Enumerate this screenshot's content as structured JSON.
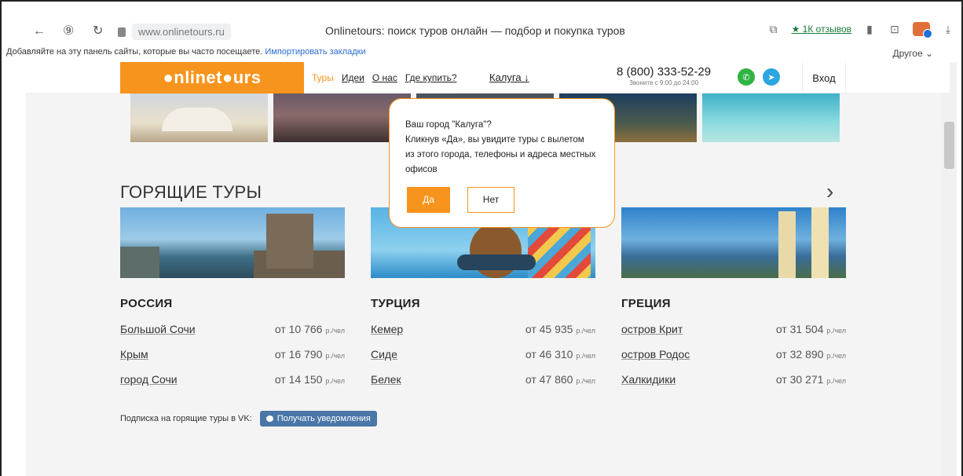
{
  "browser": {
    "url": "www.onlinetours.ru",
    "title": "Onlinetours: поиск туров онлайн — подбор и покупка туров",
    "reviews_link": "★ 1К отзывов",
    "bookmarks_prompt": "Добавляйте на эту панель сайты, которые вы часто посещаете.",
    "import_bookmarks": "Импортировать закладки",
    "other": "Другое ⌄"
  },
  "header": {
    "logo": "●nlinet●urs",
    "nav": [
      "Туры",
      "Идеи",
      "О нас",
      "Где купить?"
    ],
    "city": "Калуга ↓",
    "phone": "8 (800) 333-52-29",
    "phone_note": "Звоните с 9:00 до 24:00",
    "login": "Вход",
    "colors": {
      "brand": "#f7941d",
      "whatsapp": "#2fb343",
      "telegram": "#2ca5e0"
    }
  },
  "popup": {
    "question": "Ваш город \"Калуга\"?",
    "text_line1": "Кликнув «Да», вы увидите туры с вылетом",
    "text_line2": "из этого города, телефоны и адреса местных",
    "text_line3": "офисов",
    "yes": "Да",
    "no": "Нет"
  },
  "hot_tours": {
    "title": "ГОРЯЩИЕ ТУРЫ",
    "next": "›",
    "columns": [
      {
        "region": "РОССИЯ",
        "tours": [
          {
            "name": "Большой Сочи",
            "price": "от 10 766",
            "unit": "р./чел"
          },
          {
            "name": "Крым",
            "price": "от 16 790",
            "unit": "р./чел"
          },
          {
            "name": "город Сочи",
            "price": "от 14 150",
            "unit": "р./чел"
          }
        ]
      },
      {
        "region": "ТУРЦИЯ",
        "tours": [
          {
            "name": "Кемер",
            "price": "от 45 935",
            "unit": "р./чел"
          },
          {
            "name": "Сиде",
            "price": "от 46 310",
            "unit": "р./чел"
          },
          {
            "name": "Белек",
            "price": "от 47 860",
            "unit": "р./чел"
          }
        ]
      },
      {
        "region": "ГРЕЦИЯ",
        "tours": [
          {
            "name": "остров Крит",
            "price": "от 31 504",
            "unit": "р./чел"
          },
          {
            "name": "остров Родос",
            "price": "от 32 890",
            "unit": "р./чел"
          },
          {
            "name": "Халкидики",
            "price": "от 30 271",
            "unit": "р./чел"
          }
        ]
      }
    ]
  },
  "vk": {
    "label": "Подписка на горящие туры в VK:",
    "button": "Получать уведомления"
  }
}
